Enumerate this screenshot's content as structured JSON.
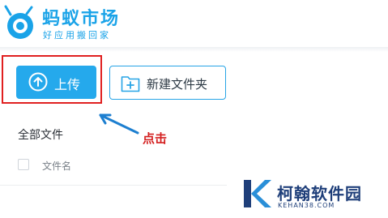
{
  "header": {
    "title": "蚂蚁市场",
    "subtitle": "好应用搬回家"
  },
  "toolbar": {
    "upload_label": "上传",
    "new_folder_label": "新建文件夹"
  },
  "annotation": {
    "text": "点击"
  },
  "files": {
    "section_title": "全部文件",
    "column_name": "文件名"
  },
  "watermark": {
    "title": "柯翰软件园",
    "url": "KEHAN38.COM"
  },
  "colors": {
    "accent": "#25a9ec",
    "highlight": "#e02020",
    "watermark": "#1f3f7a"
  },
  "icons": [
    "ant-logo-icon",
    "upload-arrow-icon",
    "folder-plus-icon",
    "k-logo-icon"
  ]
}
